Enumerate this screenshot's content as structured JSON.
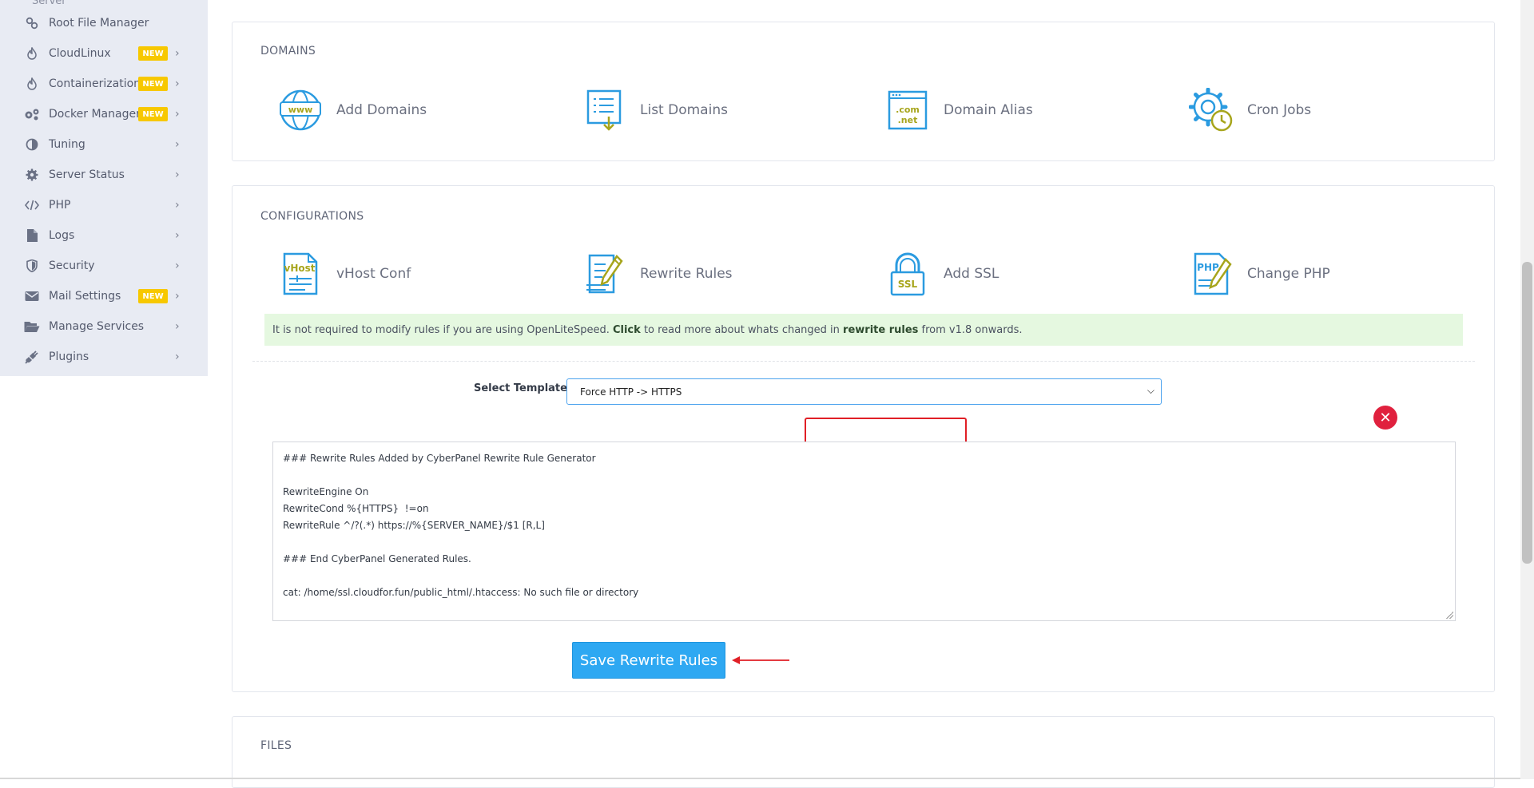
{
  "sidebar": {
    "top_partial": "Server",
    "items": [
      {
        "label": "Root File Manager",
        "icon": "link-icon",
        "badge": "",
        "chevron": false
      },
      {
        "label": "CloudLinux",
        "icon": "flame-icon",
        "badge": "NEW",
        "chevron": true
      },
      {
        "label": "Containerization",
        "icon": "flame-icon",
        "badge": "NEW",
        "chevron": true
      },
      {
        "label": "Docker Manager",
        "icon": "gears-icon",
        "badge": "NEW",
        "chevron": true
      },
      {
        "label": "Tuning",
        "icon": "half-circle-icon",
        "badge": "",
        "chevron": true
      },
      {
        "label": "Server Status",
        "icon": "gear-icon",
        "badge": "",
        "chevron": true
      },
      {
        "label": "PHP",
        "icon": "code-icon",
        "badge": "",
        "chevron": true
      },
      {
        "label": "Logs",
        "icon": "file-icon",
        "badge": "",
        "chevron": true
      },
      {
        "label": "Security",
        "icon": "shield-icon",
        "badge": "",
        "chevron": true
      },
      {
        "label": "Mail Settings",
        "icon": "envelope-icon",
        "badge": "NEW",
        "chevron": true
      },
      {
        "label": "Manage Services",
        "icon": "folder-open-icon",
        "badge": "",
        "chevron": true
      },
      {
        "label": "Plugins",
        "icon": "plug-icon",
        "badge": "",
        "chevron": true
      }
    ]
  },
  "domains": {
    "title": "DOMAINS",
    "tiles": [
      {
        "label": "Add Domains",
        "icon": "www-globe-icon"
      },
      {
        "label": "List Domains",
        "icon": "list-document-icon"
      },
      {
        "label": "Domain Alias",
        "icon": "com-net-window-icon"
      },
      {
        "label": "Cron Jobs",
        "icon": "gear-clock-icon"
      }
    ]
  },
  "configurations": {
    "title": "CONFIGURATIONS",
    "tiles": [
      {
        "label": "vHost Conf",
        "icon": "vhost-document-icon"
      },
      {
        "label": "Rewrite Rules",
        "icon": "pencil-document-icon"
      },
      {
        "label": "Add SSL",
        "icon": "ssl-lock-icon"
      },
      {
        "label": "Change PHP",
        "icon": "php-document-icon"
      }
    ],
    "notice": {
      "text1": "It is not required to modify rules if you are using OpenLiteSpeed.",
      "bold1": "Click",
      "text2": "to read more about whats changed in",
      "bold2": "rewrite rules",
      "text3": "from v1.8 onwards."
    },
    "template_label": "Select Template",
    "template_value": "Force HTTP -> HTTPS",
    "editor_lines": [
      "### Rewrite Rules Added by CyberPanel Rewrite Rule Generator",
      "",
      "RewriteEngine On",
      "RewriteCond %{HTTPS}  !=on",
      "RewriteRule ^/?(.*) https://%{SERVER_NAME}/$1 [R,L]",
      "",
      "### End CyberPanel Generated Rules.",
      "",
      "cat: /home/ssl.cloudfor.fun/public_html/.htaccess: No such file or directory"
    ],
    "save_label": "Save Rewrite Rules"
  },
  "files": {
    "title": "FILES"
  },
  "colors": {
    "accent": "#2ea8f2",
    "badge": "#f7c800",
    "danger": "#e0213e",
    "highlight_border": "#e01f26",
    "notice_bg": "#e5f8e0",
    "icon_blue": "#2b9be0",
    "icon_olive": "#a7a51c"
  }
}
